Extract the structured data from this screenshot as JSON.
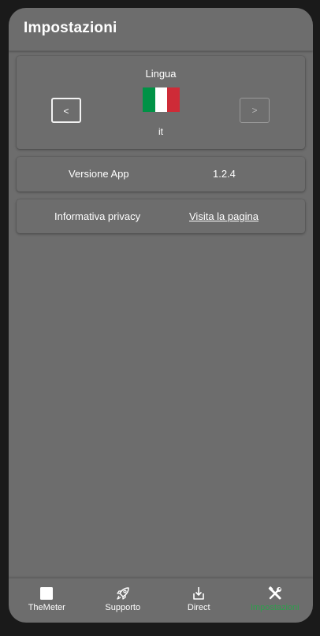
{
  "header": {
    "title": "Impostazioni"
  },
  "language": {
    "label": "Lingua",
    "prev_label": "<",
    "next_label": ">",
    "code": "it",
    "flag_colors": [
      "#009246",
      "#ffffff",
      "#ce2b37"
    ]
  },
  "version": {
    "label": "Versione App",
    "value": "1.2.4"
  },
  "privacy": {
    "label": "Informativa privacy",
    "link": "Visita la pagina"
  },
  "nav": {
    "items": [
      {
        "label": "TheMeter",
        "icon": "square-icon"
      },
      {
        "label": "Supporto",
        "icon": "rocket-icon"
      },
      {
        "label": "Direct",
        "icon": "download-icon"
      },
      {
        "label": "Impostazioni",
        "icon": "tools-icon",
        "active": true
      }
    ]
  },
  "colors": {
    "background": "#6d6d6d",
    "accent": "#2e9e4c"
  }
}
